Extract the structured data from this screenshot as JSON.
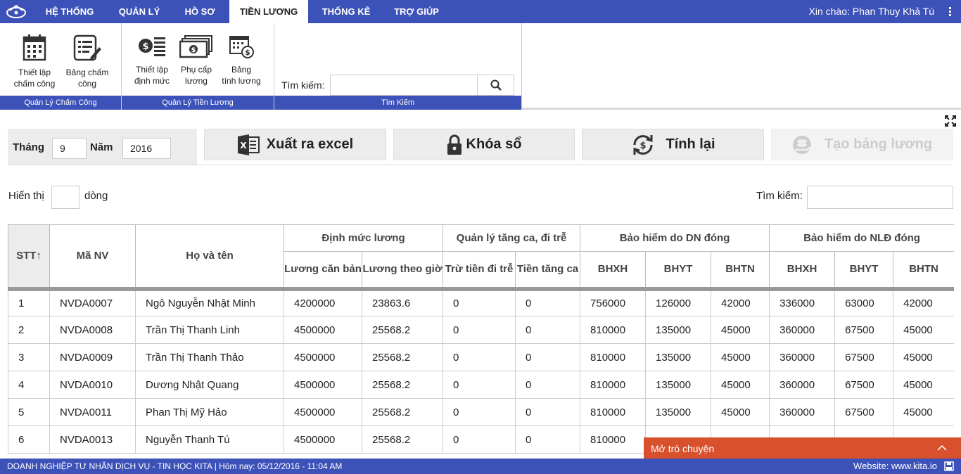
{
  "nav": {
    "tabs": [
      {
        "label": "HỆ THỐNG"
      },
      {
        "label": "QUẢN LÝ"
      },
      {
        "label": "HỒ SƠ"
      },
      {
        "label": "TIỀN LƯƠNG"
      },
      {
        "label": "THỐNG KÊ"
      },
      {
        "label": "TRỢ GIÚP"
      }
    ],
    "active_tab": "TIỀN LƯƠNG",
    "greeting": "Xin chào: Phan Thuy Khả Tú"
  },
  "ribbon": {
    "groups": [
      {
        "title": "Quản Lý Chấm Công",
        "buttons": [
          {
            "line1": "Thiết lập",
            "line2": "chấm công",
            "icon": "calendar-icon"
          },
          {
            "line1": "Bảng chấm",
            "line2": "công",
            "icon": "timesheet-edit-icon"
          }
        ]
      },
      {
        "title": "Quản Lý Tiền Lương",
        "buttons": [
          {
            "line1": "Thiết lập",
            "line2": "định mức",
            "icon": "coins-list-icon"
          },
          {
            "line1": "Phụ cấp",
            "line2": "lương",
            "icon": "banknotes-icon"
          },
          {
            "line1": "Bảng",
            "line2": "tính lương",
            "icon": "calendar-dollar-icon"
          }
        ]
      },
      {
        "title": "Tìm Kiếm"
      }
    ],
    "search_label": "Tìm kiếm:",
    "search_value": ""
  },
  "filter": {
    "month_label": "Tháng",
    "month_value": "9",
    "year_label": "Năm",
    "year_value": "2016"
  },
  "actions": {
    "export_excel": "Xuất ra excel",
    "lock": "Khóa sổ",
    "recalc": "Tính lại",
    "create_payroll": "Tạo bảng lương"
  },
  "list_controls": {
    "show_label": "Hiển thị",
    "rows_label": "dòng",
    "search_label": "Tìm kiếm:"
  },
  "table": {
    "group_headers": {
      "stt": "STT↑",
      "ma_nv": "Mã NV",
      "ho_ten": "Họ và tên",
      "dinh_muc": "Định mức lương",
      "tang_ca": "Quản lý tăng ca, đi trễ",
      "bh_dn": "Bảo hiểm do DN đóng",
      "bh_nld": "Bảo hiểm do NLĐ đóng"
    },
    "sub_headers": {
      "luong_can_ban": "Lương căn bản",
      "luong_theo_gio": "Lương theo giờ",
      "tru_tien": "Trừ tiền đi trễ",
      "tien_tang_ca": "Tiền tăng ca",
      "dn_bhxh": "BHXH",
      "dn_bhyt": "BHYT",
      "dn_bhtn": "BHTN",
      "nld_bhxh": "BHXH",
      "nld_bhyt": "BHYT",
      "nld_bhtn": "BHTN"
    },
    "rows": [
      [
        "1",
        "NVDA0007",
        "Ngô Nguyễn Nhật Minh",
        "4200000",
        "23863.6",
        "0",
        "0",
        "756000",
        "126000",
        "42000",
        "336000",
        "63000",
        "42000"
      ],
      [
        "2",
        "NVDA0008",
        "Trần Thị Thanh Linh",
        "4500000",
        "25568.2",
        "0",
        "0",
        "810000",
        "135000",
        "45000",
        "360000",
        "67500",
        "45000"
      ],
      [
        "3",
        "NVDA0009",
        "Trần Thị Thanh Thảo",
        "4500000",
        "25568.2",
        "0",
        "0",
        "810000",
        "135000",
        "45000",
        "360000",
        "67500",
        "45000"
      ],
      [
        "4",
        "NVDA0010",
        "Dương Nhật Quang",
        "4500000",
        "25568.2",
        "0",
        "0",
        "810000",
        "135000",
        "45000",
        "360000",
        "67500",
        "45000"
      ],
      [
        "5",
        "NVDA0011",
        "Phan Thị Mỹ Hảo",
        "4500000",
        "25568.2",
        "0",
        "0",
        "810000",
        "135000",
        "45000",
        "360000",
        "67500",
        "45000"
      ],
      [
        "6",
        "NVDA0013",
        "Nguyễn Thanh Tú",
        "4500000",
        "25568.2",
        "0",
        "0",
        "810000",
        "",
        "",
        "",
        "",
        ""
      ]
    ]
  },
  "footer": {
    "left": "DOANH NGHIỆP TƯ NHÂN DỊCH VỤ - TIN HỌC KITA | Hôm nay: 05/12/2016 - 11:04 AM",
    "right": "Website: www.kita.io"
  },
  "chat": {
    "label": "Mở trò chuyện"
  },
  "colors": {
    "primary": "#3d52b8",
    "chat": "#d9512c",
    "toolbar_bg": "#ececec"
  }
}
